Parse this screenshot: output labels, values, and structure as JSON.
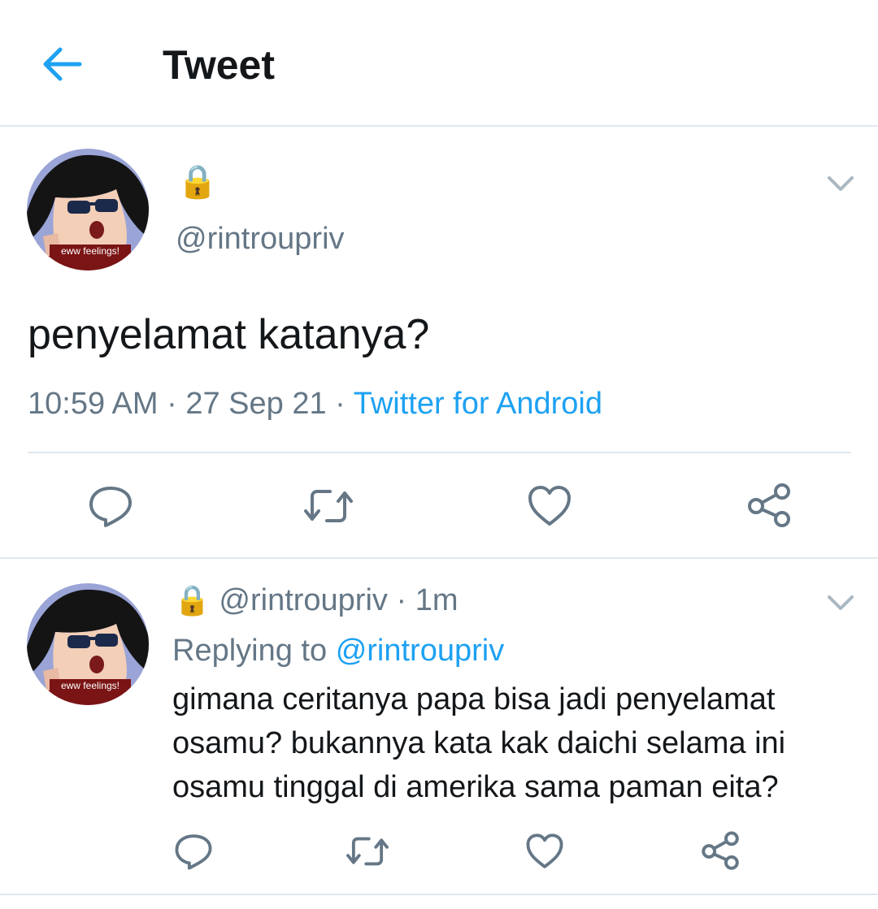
{
  "header": {
    "title": "Tweet",
    "back_icon": "arrow-left-icon",
    "accent": "#1da1f2"
  },
  "tweet": {
    "avatar_caption": "eww feelings!",
    "lock_emoji": "🔒",
    "handle": "@rintroupriv",
    "text": "penyelamat katanya?",
    "time": "10:59 AM",
    "date": "27 Sep 21",
    "source": "Twitter for Android",
    "actions": [
      "reply-icon",
      "retweet-icon",
      "like-icon",
      "share-icon"
    ]
  },
  "reply": {
    "avatar_caption": "eww feelings!",
    "lock_emoji": "🔒",
    "handle": "@rintroupriv",
    "time_ago": "1m",
    "replying_label": "Replying to",
    "replying_to": "@rintroupriv",
    "lines": [
      "gimana ceritanya papa bisa jadi penyelamat",
      "osamu? bukannya kata kak daichi selama ini",
      "osamu tinggal di amerika sama paman eita?"
    ],
    "actions": [
      "reply-icon",
      "retweet-icon",
      "like-icon",
      "share-icon"
    ]
  },
  "colors": {
    "text": "#14171a",
    "secondary": "#657786",
    "link": "#1da1f2",
    "border": "#e1e8ed"
  }
}
